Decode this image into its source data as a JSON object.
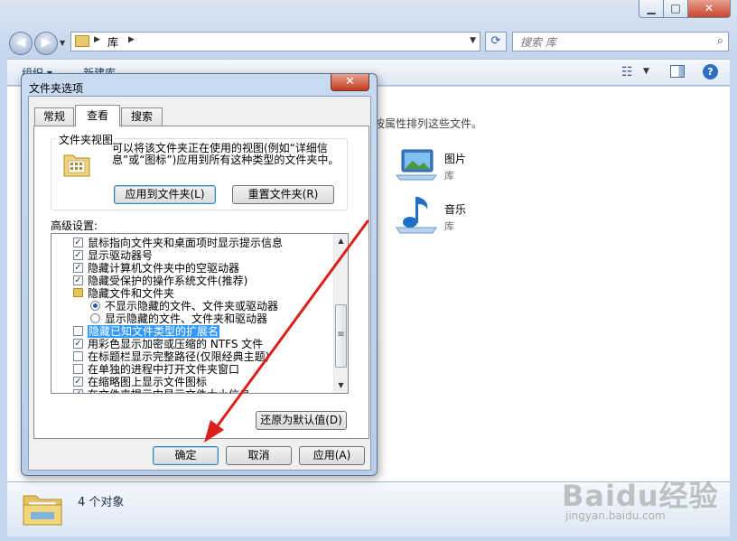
{
  "explorer": {
    "window_controls": {
      "minimize": "▁",
      "maximize": "□",
      "close": "✕"
    },
    "address": {
      "root_label": "库"
    },
    "search": {
      "placeholder": "搜索 库"
    },
    "toolbar": {
      "organize_label": "组织 ▾",
      "new_library_label": "新建库"
    },
    "content_hint": "按属性排列这些文件。",
    "libraries": [
      {
        "name": "图片",
        "type": "库",
        "icon": "pictures-library-icon"
      },
      {
        "name": "音乐",
        "type": "库",
        "icon": "music-library-icon"
      }
    ],
    "status": "4 个对象"
  },
  "dialog": {
    "title": "文件夹选项",
    "close_glyph": "✕",
    "tabs": [
      {
        "label": "常规",
        "active": false
      },
      {
        "label": "查看",
        "active": true
      },
      {
        "label": "搜索",
        "active": false
      }
    ],
    "folder_views": {
      "legend": "文件夹视图",
      "description": "可以将该文件夹正在使用的视图(例如“详细信息”或“图标”)应用到所有这种类型的文件夹中。",
      "apply_button": "应用到文件夹(L)",
      "reset_button": "重置文件夹(R)"
    },
    "advanced": {
      "label": "高级设置:",
      "items": [
        {
          "kind": "checkbox",
          "checked": true,
          "text": "鼠标指向文件夹和桌面项时显示提示信息",
          "indent": 1
        },
        {
          "kind": "checkbox",
          "checked": true,
          "text": "显示驱动器号",
          "indent": 1
        },
        {
          "kind": "checkbox",
          "checked": true,
          "text": "隐藏计算机文件夹中的空驱动器",
          "indent": 1
        },
        {
          "kind": "checkbox",
          "checked": true,
          "text": "隐藏受保护的操作系统文件(推荐)",
          "indent": 1
        },
        {
          "kind": "folder",
          "checked": false,
          "text": "隐藏文件和文件夹",
          "indent": 1
        },
        {
          "kind": "radio",
          "checked": true,
          "text": "不显示隐藏的文件、文件夹或驱动器",
          "indent": 2
        },
        {
          "kind": "radio",
          "checked": false,
          "text": "显示隐藏的文件、文件夹和驱动器",
          "indent": 2
        },
        {
          "kind": "checkbox",
          "checked": false,
          "text": "隐藏已知文件类型的扩展名",
          "indent": 1,
          "selected": true
        },
        {
          "kind": "checkbox",
          "checked": true,
          "text": "用彩色显示加密或压缩的 NTFS 文件",
          "indent": 1
        },
        {
          "kind": "checkbox",
          "checked": false,
          "text": "在标题栏显示完整路径(仅限经典主题)",
          "indent": 1
        },
        {
          "kind": "checkbox",
          "checked": false,
          "text": "在单独的进程中打开文件夹窗口",
          "indent": 1
        },
        {
          "kind": "checkbox",
          "checked": true,
          "text": "在缩略图上显示文件图标",
          "indent": 1
        },
        {
          "kind": "checkbox",
          "checked": true,
          "text": "在文件夹提示中显示文件大小信息",
          "indent": 1
        }
      ],
      "restore_button": "还原为默认值(D)"
    },
    "buttons": {
      "ok": "确定",
      "cancel": "取消",
      "apply": "应用(A)"
    }
  },
  "watermark": {
    "main": "Baidu经验",
    "sub": "jingyan.baidu.com"
  },
  "colors": {
    "annotation_arrow": "#d9201c",
    "selection": "#3399ff",
    "close_red": "#c43b22"
  }
}
